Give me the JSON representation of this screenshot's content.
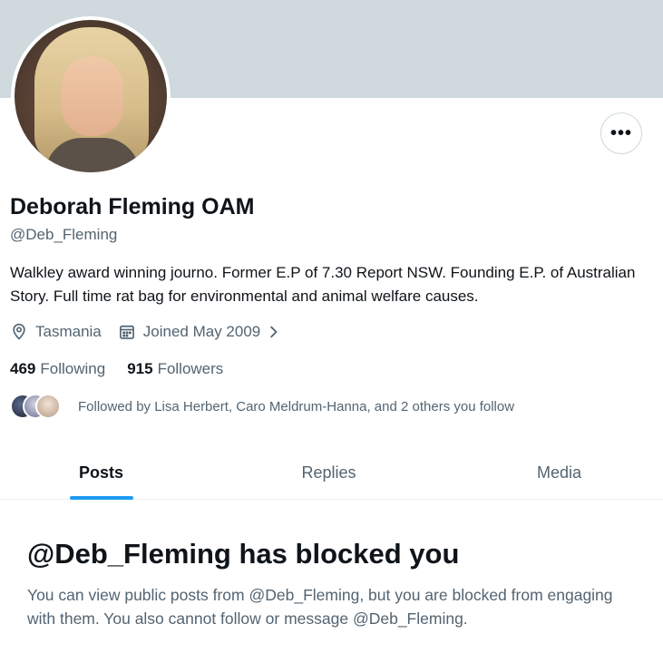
{
  "profile": {
    "display_name": "Deborah Fleming OAM",
    "handle": "@Deb_Fleming",
    "bio": "Walkley award winning journo. Former E.P of 7.30 Report NSW. Founding E.P. of Australian Story. Full time rat bag for environmental and animal welfare causes.",
    "location": "Tasmania",
    "joined": "Joined May 2009",
    "following_count": "469",
    "following_label": "Following",
    "followers_count": "915",
    "followers_label": "Followers",
    "followed_by": "Followed by Lisa Herbert, Caro Meldrum-Hanna, and 2 others you follow",
    "more_icon": "more-horizontal-icon"
  },
  "tabs": [
    {
      "label": "Posts",
      "active": true
    },
    {
      "label": "Replies",
      "active": false
    },
    {
      "label": "Media",
      "active": false
    }
  ],
  "blocked": {
    "title": "@Deb_Fleming has blocked you",
    "message": "You can view public posts from @Deb_Fleming, but you are blocked from engaging with them. You also cannot follow or message @Deb_Fleming."
  },
  "colors": {
    "banner": "#cfd9de",
    "accent": "#1d9bf0",
    "text_primary": "#0f1419",
    "text_secondary": "#536471"
  }
}
